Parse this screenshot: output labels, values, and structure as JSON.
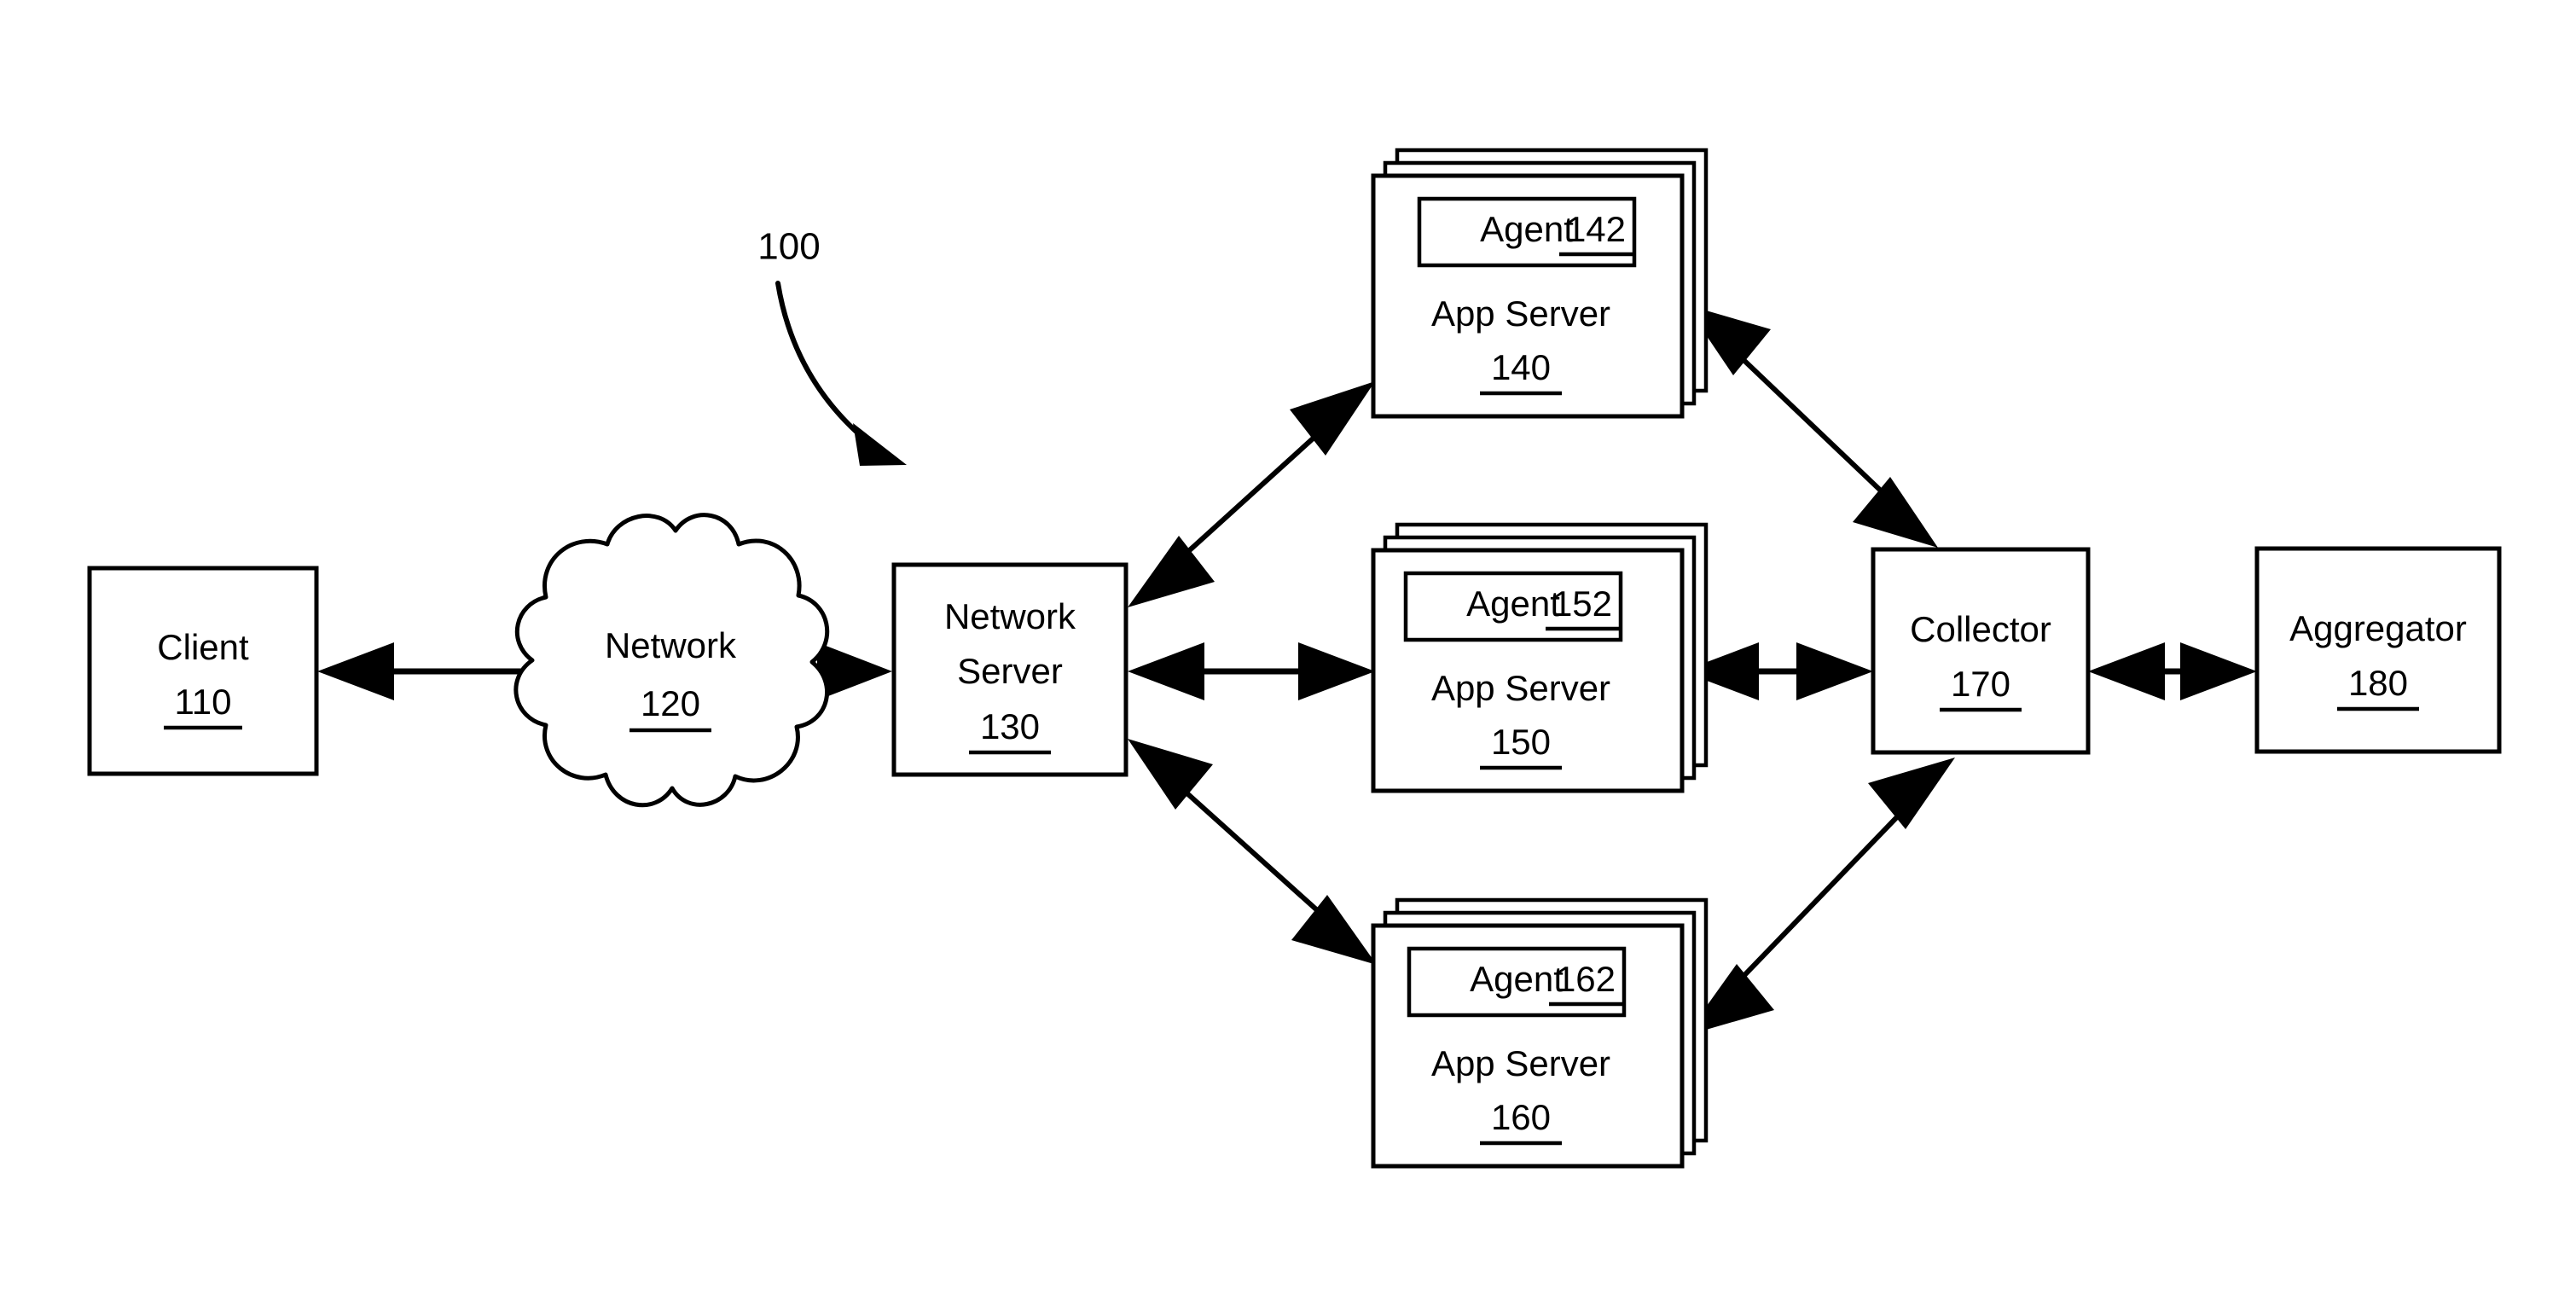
{
  "figure": {
    "reference_numeral": "100",
    "pointer_icon": "curved-arrow-icon"
  },
  "nodes": {
    "client": {
      "label": "Client",
      "ref": "110",
      "shape": "rectangle"
    },
    "network": {
      "label": "Network",
      "ref": "120",
      "shape": "cloud"
    },
    "network_server": {
      "label_line1": "Network",
      "label_line2": "Server",
      "ref": "130",
      "shape": "rectangle"
    },
    "app_server_140": {
      "label_line1": "App Server",
      "ref": "140",
      "agent_label": "Agent",
      "agent_ref": "142",
      "shape": "stacked-rectangle",
      "stack_count": 3
    },
    "app_server_150": {
      "label_line1": "App Server",
      "ref": "150",
      "agent_label": "Agent",
      "agent_ref": "152",
      "shape": "stacked-rectangle",
      "stack_count": 3
    },
    "app_server_160": {
      "label_line1": "App Server",
      "ref": "160",
      "agent_label": "Agent",
      "agent_ref": "162",
      "shape": "stacked-rectangle",
      "stack_count": 3
    },
    "collector": {
      "label": "Collector",
      "ref": "170",
      "shape": "rectangle"
    },
    "aggregator": {
      "label": "Aggregator",
      "ref": "180",
      "shape": "rectangle"
    }
  },
  "connections": [
    {
      "from": "client",
      "to": "network",
      "style": "double-arrow-horizontal"
    },
    {
      "from": "network",
      "to": "network_server",
      "style": "double-arrow-horizontal"
    },
    {
      "from": "network_server",
      "to": "app_server_140",
      "style": "double-arrow-diagonal-up"
    },
    {
      "from": "network_server",
      "to": "app_server_150",
      "style": "double-arrow-horizontal"
    },
    {
      "from": "network_server",
      "to": "app_server_160",
      "style": "double-arrow-diagonal-down"
    },
    {
      "from": "app_server_140",
      "to": "collector",
      "style": "double-arrow-diagonal-down"
    },
    {
      "from": "app_server_150",
      "to": "collector",
      "style": "double-arrow-horizontal"
    },
    {
      "from": "app_server_160",
      "to": "collector",
      "style": "double-arrow-diagonal-up"
    },
    {
      "from": "collector",
      "to": "aggregator",
      "style": "double-arrow-horizontal"
    }
  ],
  "colors": {
    "stroke": "#000000",
    "fill": "#ffffff",
    "text": "#000000"
  }
}
